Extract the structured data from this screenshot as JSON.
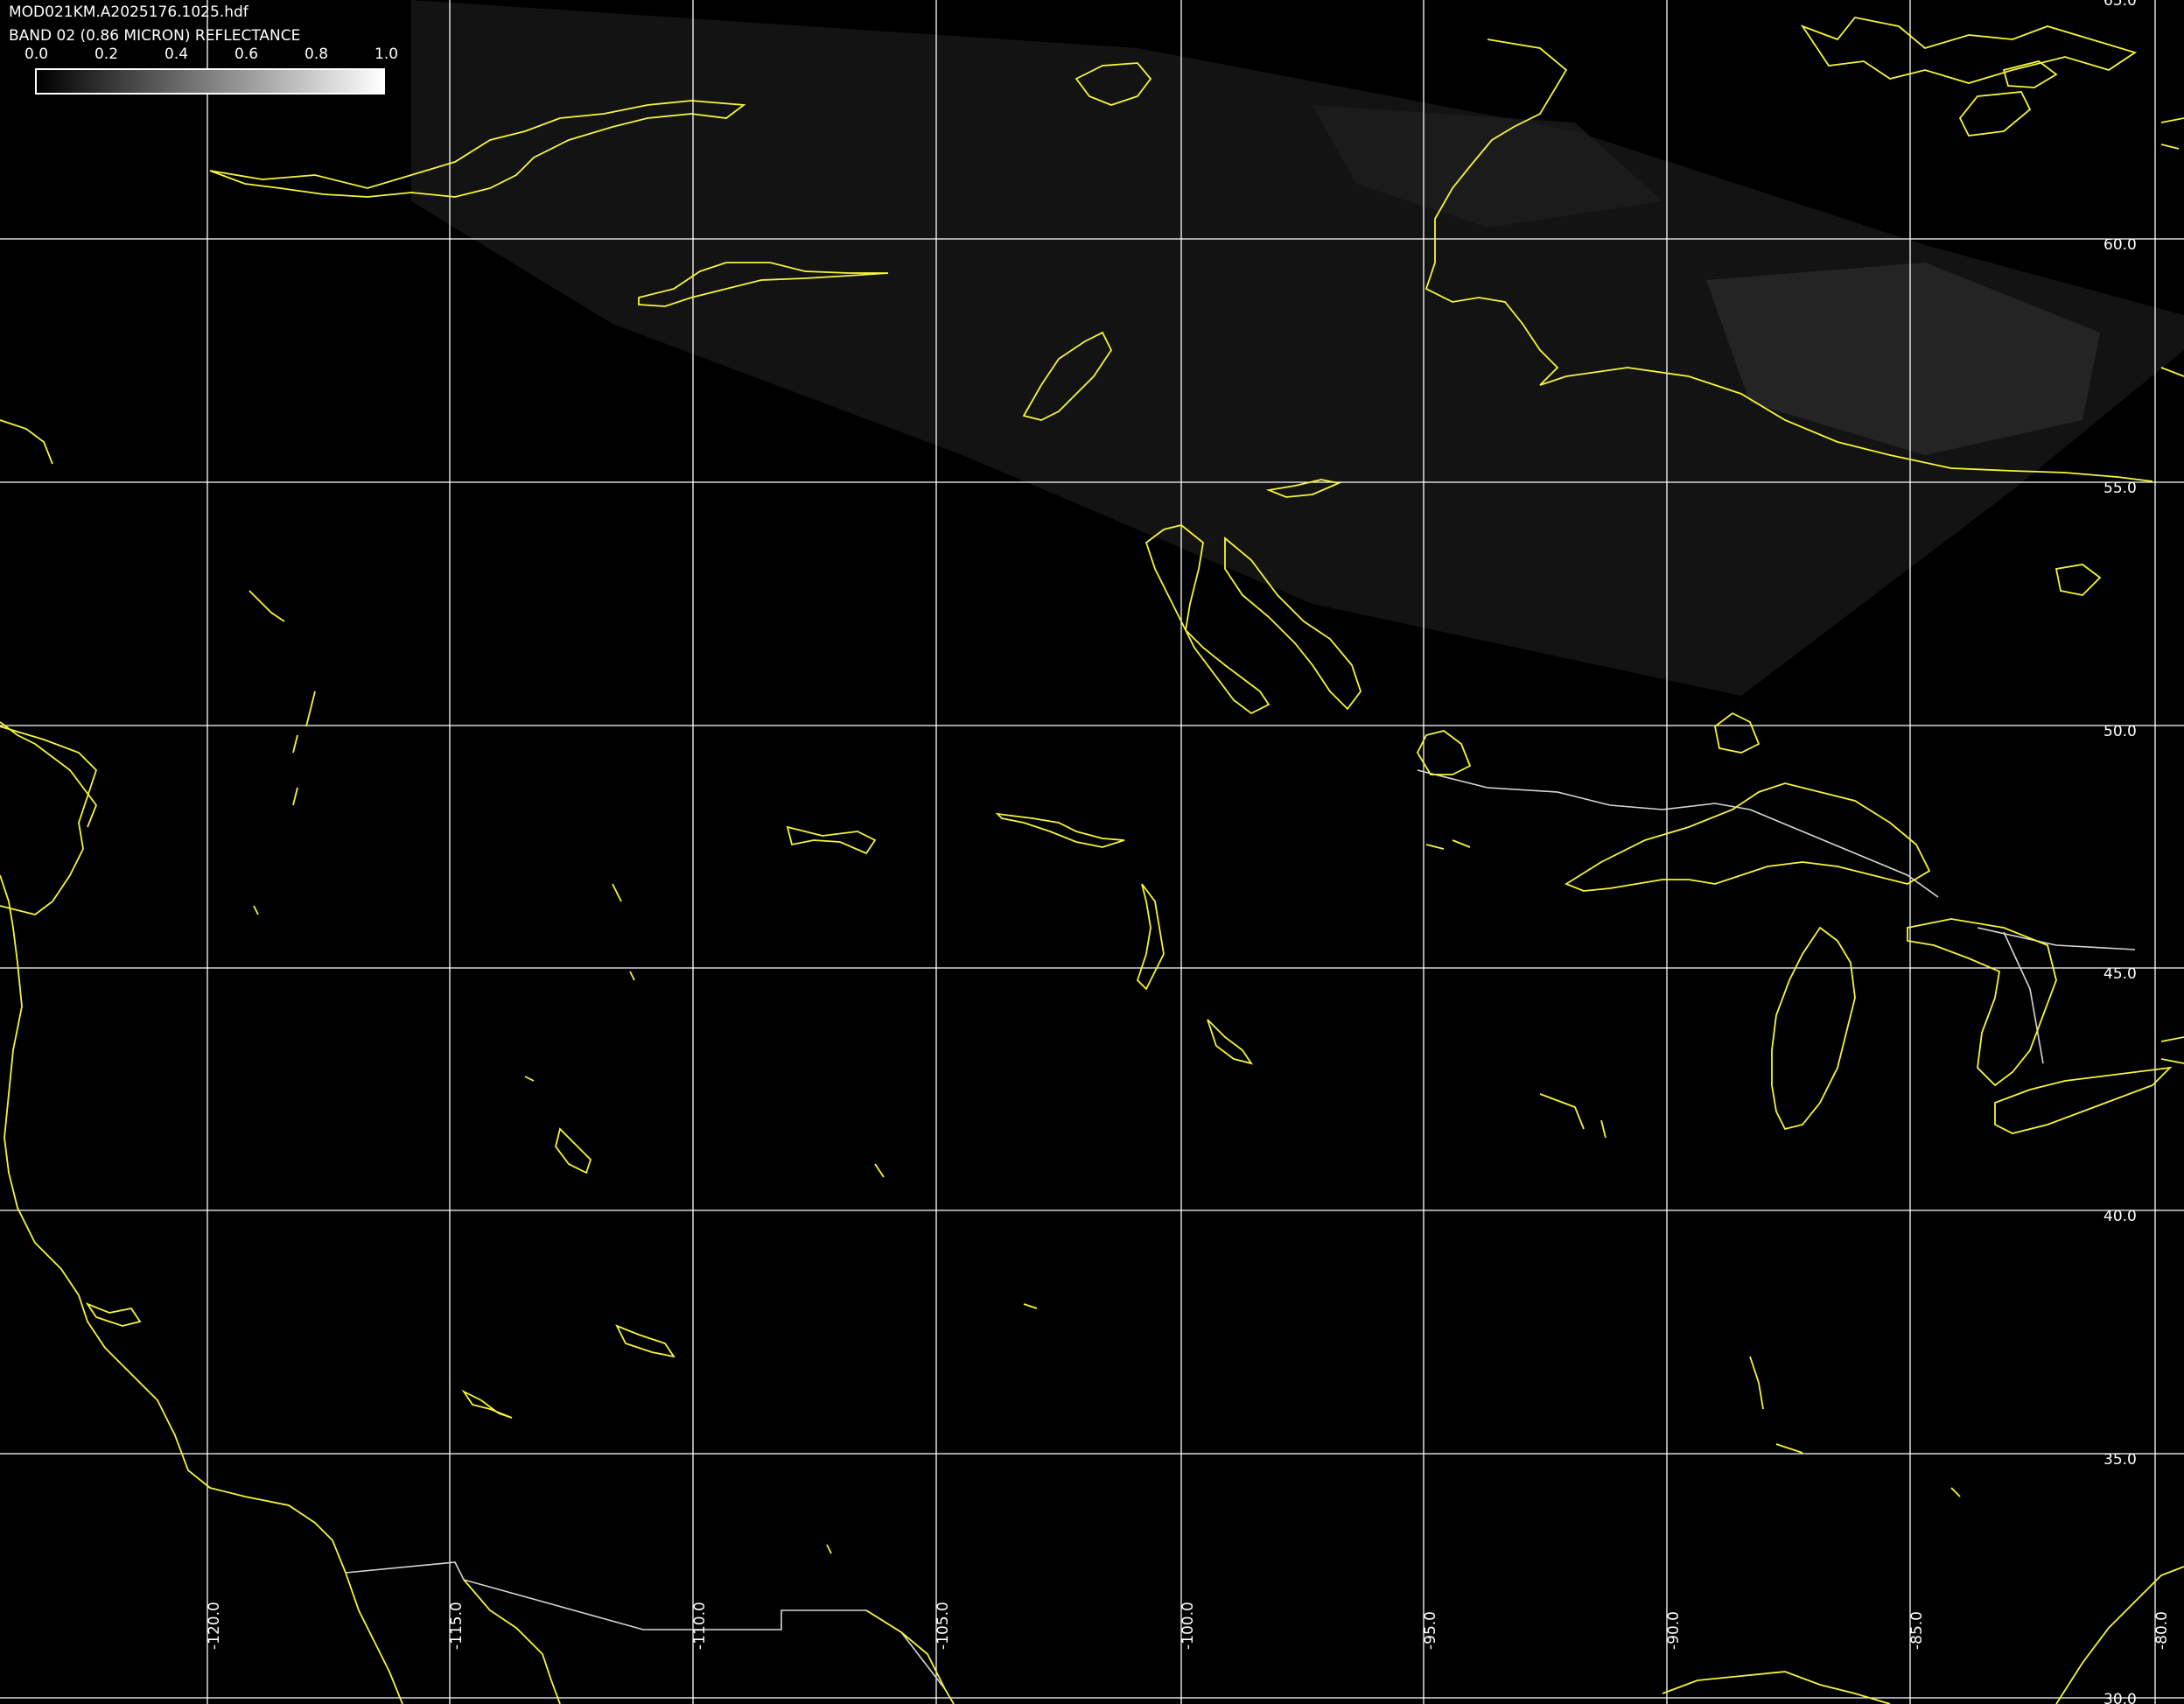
{
  "header": {
    "filename": "MOD021KM.A2025176.1025.hdf",
    "band_label": "BAND 02 (0.86 MICRON) REFLECTANCE"
  },
  "colorbar": {
    "tick_labels": [
      "0.0",
      "0.2",
      "0.4",
      "0.6",
      "0.8",
      "1.0"
    ],
    "min": 0.0,
    "max": 1.0,
    "start_color": "#000000",
    "end_color": "#ffffff"
  },
  "map": {
    "background_color": "#000000",
    "gridline_color": "#ffffff",
    "coastline_color": "#f5f53a",
    "border_color": "#d8d8d8",
    "latitude_labels": [
      "65.0",
      "60.0",
      "55.0",
      "50.0",
      "45.0",
      "40.0",
      "35.0",
      "30.0"
    ],
    "longitude_labels": [
      "-120.0",
      "-115.0",
      "-110.0",
      "-105.0",
      "-100.0",
      "-95.0",
      "-90.0",
      "-85.0",
      "-80.0"
    ]
  }
}
